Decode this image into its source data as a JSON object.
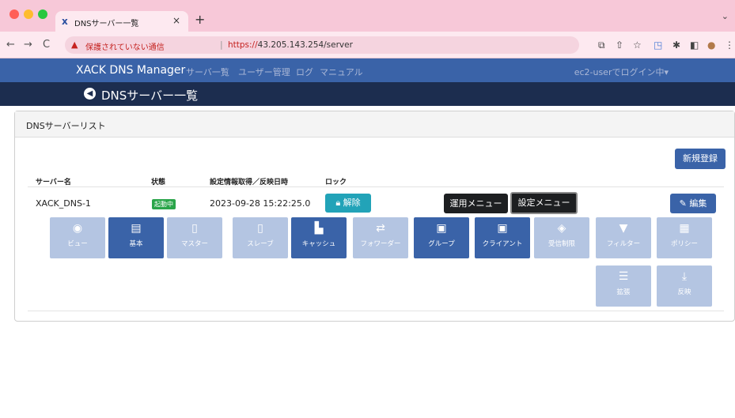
{
  "browser": {
    "tab_title": "DNSサーバー一覧",
    "new_tab": "+",
    "not_secure": "保護されていない通信",
    "url_scheme": "https://",
    "url_rest": "43.205.143.254/server"
  },
  "nav": {
    "brand": "XACK DNS Manager",
    "links": [
      "サーバ一覧",
      "ユーザー管理",
      "ログ",
      "マニュアル"
    ],
    "user": "ec2-userでログイン中▾"
  },
  "page": {
    "title": "DNSサーバー一覧"
  },
  "card": {
    "header": "DNSサーバーリスト",
    "new_button": "新規登録",
    "columns": [
      "サーバー名",
      "状態",
      "設定情報取得／反映日時",
      "ロック"
    ],
    "row": {
      "name": "XACK_DNS-1",
      "status": "起動中",
      "datetime": "2023-09-28 15:22:25.0",
      "unlock": "解除",
      "ops_menu": "運用メニュー",
      "settings_menu": "設定メニュー",
      "edit": "編集"
    },
    "tiles": [
      {
        "label": "ビュー",
        "icon": "◉",
        "active": false
      },
      {
        "label": "基本",
        "icon": "▤",
        "active": true
      },
      {
        "label": "マスター",
        "icon": "▯",
        "active": false
      },
      {
        "label": "スレーブ",
        "icon": "▯",
        "active": false
      },
      {
        "label": "キャッシュ",
        "icon": "▙",
        "active": true
      },
      {
        "label": "フォワーダー",
        "icon": "⇄",
        "active": false
      },
      {
        "label": "グループ",
        "icon": "▣",
        "active": true
      },
      {
        "label": "クライアント",
        "icon": "▣",
        "active": true
      },
      {
        "label": "受信制限",
        "icon": "◈",
        "active": false
      },
      {
        "label": "フィルター",
        "icon": "▼",
        "active": false
      },
      {
        "label": "ポリシー",
        "icon": "▦",
        "active": false
      },
      {
        "label": "拡張",
        "icon": "☰",
        "active": false
      },
      {
        "label": "反映",
        "icon": "⤓",
        "active": false
      }
    ]
  }
}
